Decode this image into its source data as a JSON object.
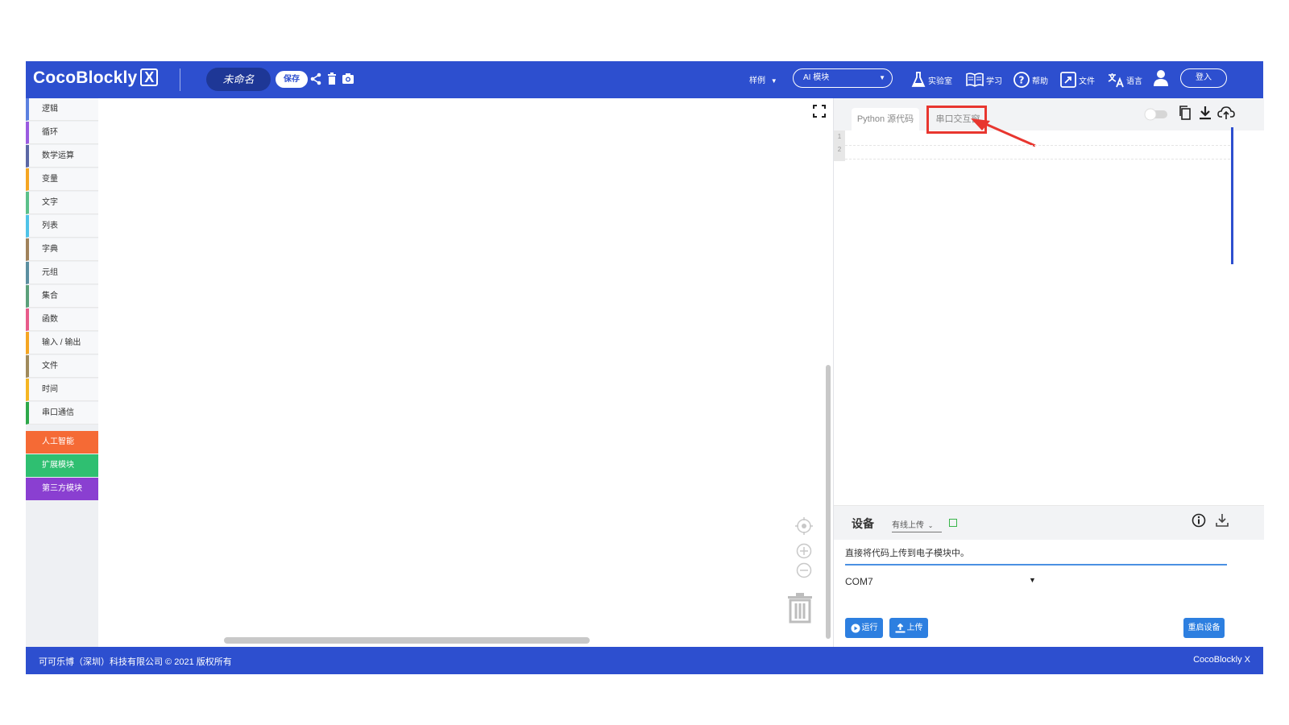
{
  "header": {
    "logo_text": "CocoBlockly",
    "logo_badge": "X",
    "project_name": "未命名",
    "save_label": "保存",
    "samples_label": "样例",
    "ai_module_label": "AI 模块",
    "nav": {
      "lab": "实验室",
      "learn": "学习",
      "help": "帮助",
      "file": "文件",
      "language": "语言"
    },
    "login_label": "登入"
  },
  "sidebar": {
    "categories": [
      {
        "label": "逻辑",
        "color": "#5b80e0"
      },
      {
        "label": "循环",
        "color": "#9a5be0"
      },
      {
        "label": "数学运算",
        "color": "#5b67a5"
      },
      {
        "label": "变量",
        "color": "#f5a623"
      },
      {
        "label": "文字",
        "color": "#5bc08a"
      },
      {
        "label": "列表",
        "color": "#4fc3e8"
      },
      {
        "label": "字典",
        "color": "#a0825b"
      },
      {
        "label": "元组",
        "color": "#5b8fa0"
      },
      {
        "label": "集合",
        "color": "#5ba07a"
      },
      {
        "label": "函数",
        "color": "#e85b8a"
      },
      {
        "label": "输入 / 输出",
        "color": "#f5a623"
      },
      {
        "label": "文件",
        "color": "#a08a5b"
      },
      {
        "label": "时间",
        "color": "#f5b623"
      },
      {
        "label": "串口通信",
        "color": "#2ea84a"
      }
    ],
    "blocks": [
      {
        "label": "人工智能",
        "color": "#f56a35"
      },
      {
        "label": "扩展模块",
        "color": "#2fbf71"
      },
      {
        "label": "第三方模块",
        "color": "#8a3fd1"
      }
    ]
  },
  "code_panel": {
    "tabs": {
      "python": "Python 源代码",
      "serial": "串口交互窗"
    },
    "line_numbers": [
      "1",
      "2"
    ]
  },
  "device": {
    "title": "设备",
    "upload_mode": "有线上传",
    "description": "直接将代码上传到电子模块中。",
    "port": "COM7",
    "run_label": "运行",
    "upload_label": "上传",
    "restart_label": "重启设备"
  },
  "footer": {
    "copyright": "可可乐博（深圳）科技有限公司 © 2021 版权所有",
    "brand": "CocoBlockly X"
  },
  "colors": {
    "brand_blue": "#2d4fcf",
    "highlight_red": "#e8362f",
    "button_blue": "#2d7fe0"
  }
}
